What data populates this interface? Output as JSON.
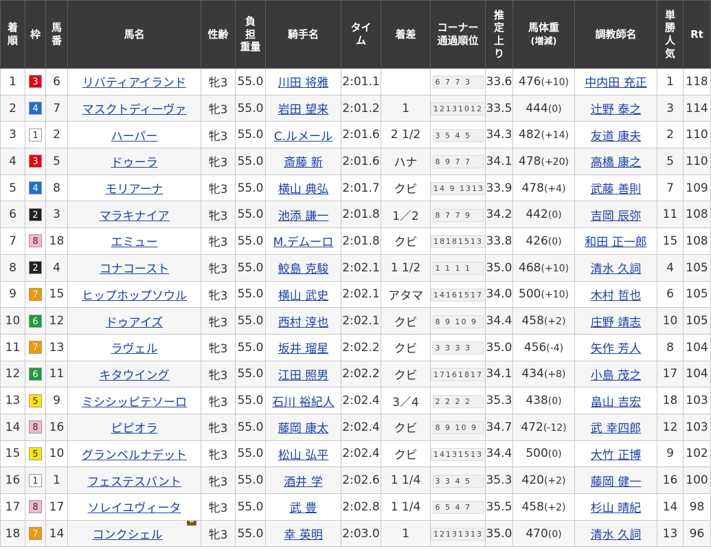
{
  "headers": {
    "finish": "着順",
    "frame": "枠",
    "horse_no": "馬番",
    "horse_name": "馬名",
    "sex_age": "性齢",
    "weight_carried": "負担重量",
    "jockey": "騎手名",
    "time": "タイム",
    "margin": "着差",
    "corner": "コーナー通過順位",
    "last3f": "推定上り",
    "body_weight": "馬体重",
    "body_weight_sub": "(増減)",
    "trainer": "調教師名",
    "popularity": "単勝人気",
    "rating": "Rt"
  },
  "frame_colors": {
    "1": {
      "bg": "#ffffff",
      "fg": "#333333"
    },
    "2": {
      "bg": "#222222",
      "fg": "#ffffff"
    },
    "3": {
      "bg": "#e60012",
      "fg": "#ffffff"
    },
    "4": {
      "bg": "#1e6fd8",
      "fg": "#ffffff"
    },
    "5": {
      "bg": "#ffe600",
      "fg": "#333333"
    },
    "6": {
      "bg": "#1f9a3f",
      "fg": "#ffffff"
    },
    "7": {
      "bg": "#f39800",
      "fg": "#ffffff"
    },
    "8": {
      "bg": "#f8b6cf",
      "fg": "#333333"
    }
  },
  "rows": [
    {
      "finish": "1",
      "frame": "3",
      "horse_no": "6",
      "name": "リバティアイランド",
      "sex_age": "牝3",
      "weight": "55.0",
      "jockey": "川田 将雅",
      "time": "2:01.1",
      "margin": "",
      "corner": "6 7 7 3",
      "last3f": "33.6",
      "bw": "476",
      "bw_diff": "(+10)",
      "trainer": "中内田 充正",
      "pop": "1",
      "rt": "118",
      "blinker": ""
    },
    {
      "finish": "2",
      "frame": "4",
      "horse_no": "7",
      "name": "マスクトディーヴァ",
      "sex_age": "牝3",
      "weight": "55.0",
      "jockey": "岩田 望来",
      "time": "2:01.2",
      "margin": "1",
      "corner": "12131012",
      "last3f": "33.5",
      "bw": "444",
      "bw_diff": "(0)",
      "trainer": "辻野 泰之",
      "pop": "3",
      "rt": "114",
      "blinker": ""
    },
    {
      "finish": "3",
      "frame": "1",
      "horse_no": "2",
      "name": "ハーパー",
      "sex_age": "牝3",
      "weight": "55.0",
      "jockey": "C.ルメール",
      "time": "2:01.6",
      "margin": "2 1/2",
      "corner": "3 5 4 5",
      "last3f": "34.3",
      "bw": "482",
      "bw_diff": "(+14)",
      "trainer": "友道 康夫",
      "pop": "2",
      "rt": "110",
      "blinker": ""
    },
    {
      "finish": "4",
      "frame": "3",
      "horse_no": "5",
      "name": "ドゥーラ",
      "sex_age": "牝3",
      "weight": "55.0",
      "jockey": "斎藤 新",
      "time": "2:01.6",
      "margin": "ハナ",
      "corner": "8 9 7 7",
      "last3f": "34.1",
      "bw": "478",
      "bw_diff": "(+20)",
      "trainer": "高橋 康之",
      "pop": "5",
      "rt": "110",
      "blinker": ""
    },
    {
      "finish": "5",
      "frame": "4",
      "horse_no": "8",
      "name": "モリアーナ",
      "sex_age": "牝3",
      "weight": "55.0",
      "jockey": "横山 典弘",
      "time": "2:01.7",
      "margin": "クビ",
      "corner": "14 9 1313",
      "last3f": "33.9",
      "bw": "478",
      "bw_diff": "(+4)",
      "trainer": "武藤 善則",
      "pop": "7",
      "rt": "109",
      "blinker": ""
    },
    {
      "finish": "6",
      "frame": "2",
      "horse_no": "3",
      "name": "マラキナイア",
      "sex_age": "牝3",
      "weight": "55.0",
      "jockey": "池添 謙一",
      "time": "2:01.8",
      "margin": "1／2",
      "corner": "8 7 7 9",
      "last3f": "34.2",
      "bw": "442",
      "bw_diff": "(0)",
      "trainer": "吉岡 辰弥",
      "pop": "11",
      "rt": "108",
      "blinker": ""
    },
    {
      "finish": "7",
      "frame": "8",
      "horse_no": "18",
      "name": "エミュー",
      "sex_age": "牝3",
      "weight": "55.0",
      "jockey": "M.デムーロ",
      "time": "2:01.8",
      "margin": "クビ",
      "corner": "18181513",
      "last3f": "33.8",
      "bw": "426",
      "bw_diff": "(0)",
      "trainer": "和田 正一郎",
      "pop": "15",
      "rt": "108",
      "blinker": ""
    },
    {
      "finish": "8",
      "frame": "2",
      "horse_no": "4",
      "name": "コナコースト",
      "sex_age": "牝3",
      "weight": "55.0",
      "jockey": "鮫島 克駿",
      "time": "2:02.1",
      "margin": "1 1/2",
      "corner": "1 1 1 1",
      "last3f": "35.0",
      "bw": "468",
      "bw_diff": "(+10)",
      "trainer": "清水 久詞",
      "pop": "4",
      "rt": "105",
      "blinker": ""
    },
    {
      "finish": "9",
      "frame": "7",
      "horse_no": "15",
      "name": "ヒップホップソウル",
      "sex_age": "牝3",
      "weight": "55.0",
      "jockey": "横山 武史",
      "time": "2:02.1",
      "margin": "アタマ",
      "corner": "14161517",
      "last3f": "34.0",
      "bw": "500",
      "bw_diff": "(+10)",
      "trainer": "木村 哲也",
      "pop": "6",
      "rt": "105",
      "blinker": ""
    },
    {
      "finish": "10",
      "frame": "6",
      "horse_no": "12",
      "name": "ドゥアイズ",
      "sex_age": "牝3",
      "weight": "55.0",
      "jockey": "西村 淳也",
      "time": "2:02.1",
      "margin": "クビ",
      "corner": "8 9 10 9",
      "last3f": "34.4",
      "bw": "458",
      "bw_diff": "(+2)",
      "trainer": "庄野 靖志",
      "pop": "10",
      "rt": "105",
      "blinker": ""
    },
    {
      "finish": "11",
      "frame": "7",
      "horse_no": "13",
      "name": "ラヴェル",
      "sex_age": "牝3",
      "weight": "55.0",
      "jockey": "坂井 瑠星",
      "time": "2:02.2",
      "margin": "クビ",
      "corner": "3 3 3 3",
      "last3f": "35.0",
      "bw": "456",
      "bw_diff": "(-4)",
      "trainer": "矢作 芳人",
      "pop": "8",
      "rt": "104",
      "blinker": ""
    },
    {
      "finish": "12",
      "frame": "6",
      "horse_no": "11",
      "name": "キタウイング",
      "sex_age": "牝3",
      "weight": "55.0",
      "jockey": "江田 照男",
      "time": "2:02.2",
      "margin": "クビ",
      "corner": "17161817",
      "last3f": "34.1",
      "bw": "434",
      "bw_diff": "(+8)",
      "trainer": "小島 茂之",
      "pop": "17",
      "rt": "104",
      "blinker": ""
    },
    {
      "finish": "13",
      "frame": "5",
      "horse_no": "9",
      "name": "ミシシッピテソーロ",
      "sex_age": "牝3",
      "weight": "55.0",
      "jockey": "石川 裕紀人",
      "time": "2:02.4",
      "margin": "3／4",
      "corner": "2 2 2 2",
      "last3f": "35.3",
      "bw": "438",
      "bw_diff": "(0)",
      "trainer": "畠山 吉宏",
      "pop": "18",
      "rt": "103",
      "blinker": ""
    },
    {
      "finish": "14",
      "frame": "8",
      "horse_no": "16",
      "name": "ピピオラ",
      "sex_age": "牝3",
      "weight": "55.0",
      "jockey": "藤岡 康太",
      "time": "2:02.4",
      "margin": "クビ",
      "corner": "8 9 10 9",
      "last3f": "34.7",
      "bw": "472",
      "bw_diff": "(-12)",
      "trainer": "武 幸四郎",
      "pop": "12",
      "rt": "103",
      "blinker": ""
    },
    {
      "finish": "15",
      "frame": "5",
      "horse_no": "10",
      "name": "グランベルナデット",
      "sex_age": "牝3",
      "weight": "55.0",
      "jockey": "松山 弘平",
      "time": "2:02.4",
      "margin": "クビ",
      "corner": "14131513",
      "last3f": "34.4",
      "bw": "500",
      "bw_diff": "(0)",
      "trainer": "大竹 正博",
      "pop": "9",
      "rt": "102",
      "blinker": ""
    },
    {
      "finish": "16",
      "frame": "1",
      "horse_no": "1",
      "name": "フェステスバント",
      "sex_age": "牝3",
      "weight": "55.0",
      "jockey": "酒井 学",
      "time": "2:02.6",
      "margin": "1 1/4",
      "corner": "3 3 4 5",
      "last3f": "35.3",
      "bw": "420",
      "bw_diff": "(+2)",
      "trainer": "藤岡 健一",
      "pop": "16",
      "rt": "100",
      "blinker": ""
    },
    {
      "finish": "17",
      "frame": "8",
      "horse_no": "17",
      "name": "ソレイユヴィータ",
      "sex_age": "牝3",
      "weight": "55.0",
      "jockey": "武 豊",
      "time": "2:02.8",
      "margin": "1 1/4",
      "corner": "6 5 4 7",
      "last3f": "35.5",
      "bw": "458",
      "bw_diff": "(+2)",
      "trainer": "杉山 晴紀",
      "pop": "14",
      "rt": "98",
      "blinker": ""
    },
    {
      "finish": "18",
      "frame": "7",
      "horse_no": "14",
      "name": "コンクシェル",
      "sex_age": "牝3",
      "weight": "55.0",
      "jockey": "幸 英明",
      "time": "2:03.0",
      "margin": "1",
      "corner": "12131313",
      "last3f": "35.0",
      "bw": "470",
      "bw_diff": "(0)",
      "trainer": "清水 久詞",
      "pop": "13",
      "rt": "96",
      "blinker": "B"
    }
  ]
}
